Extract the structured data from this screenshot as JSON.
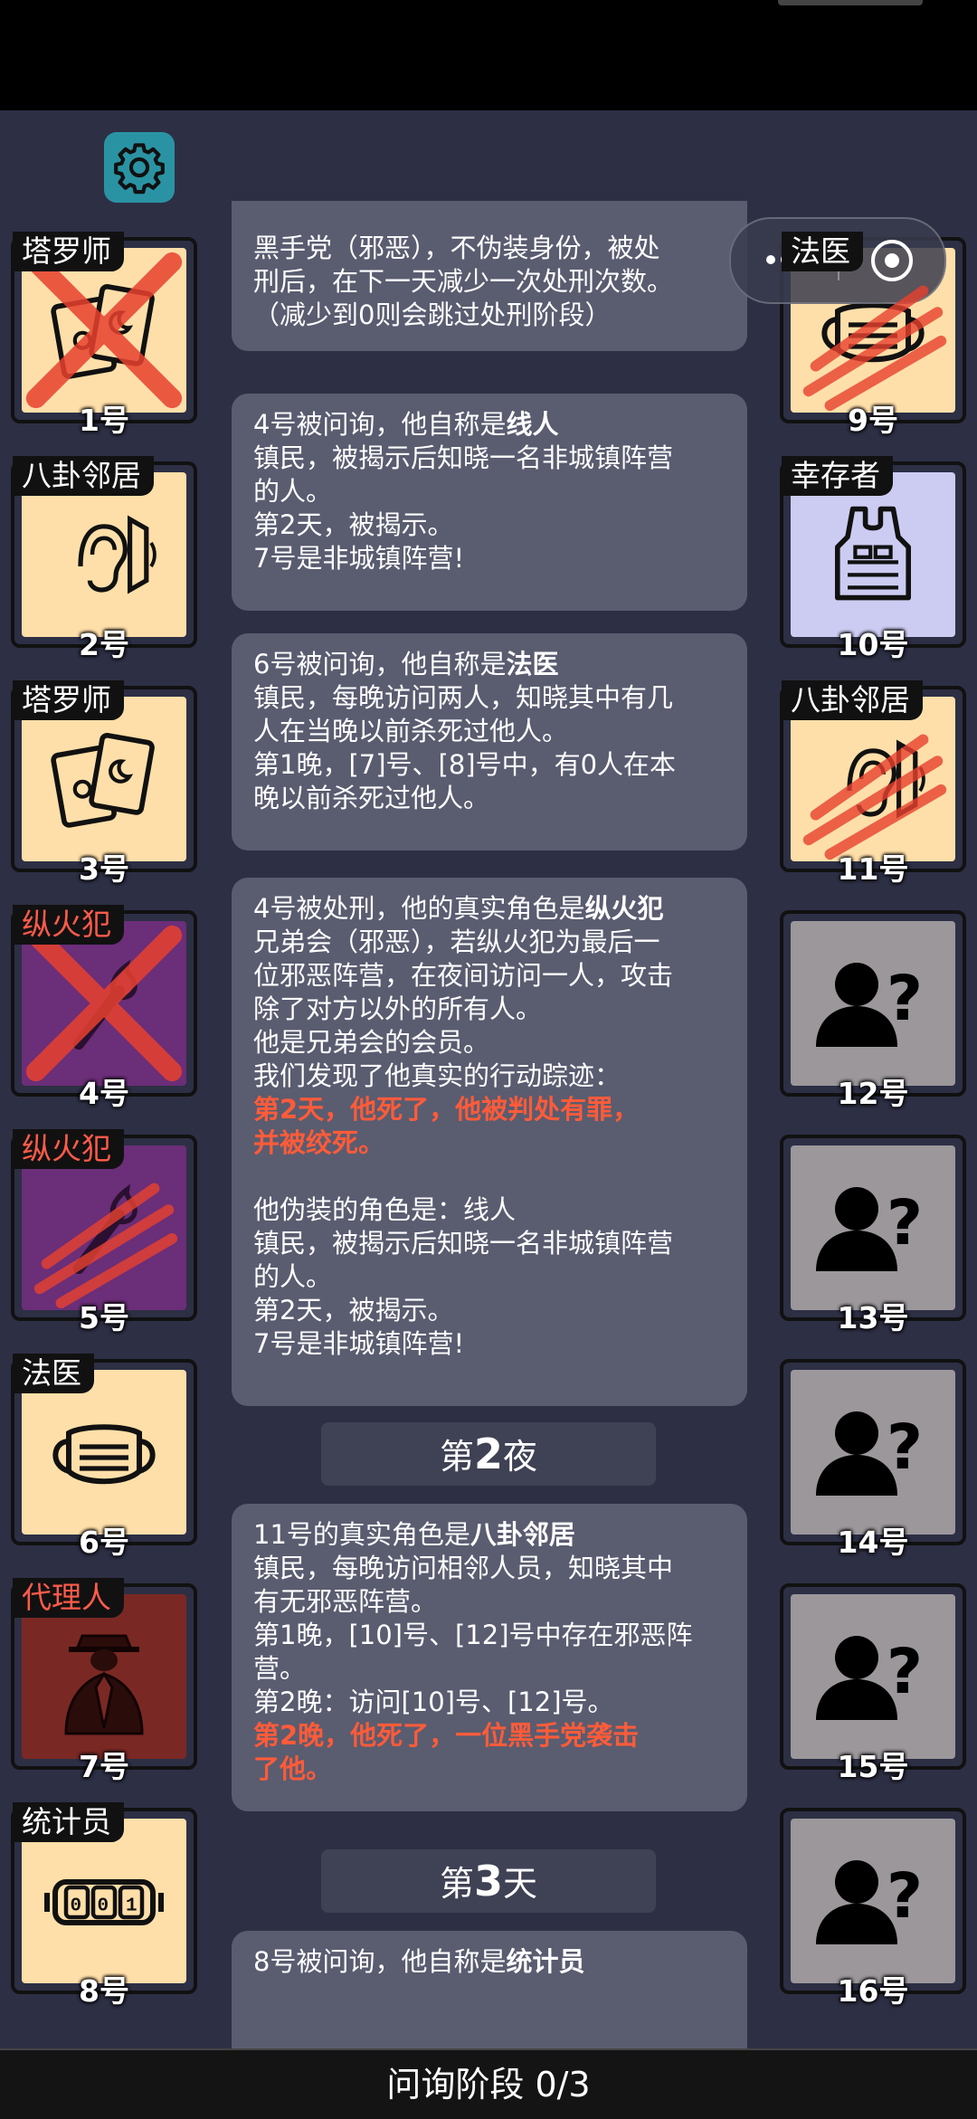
{
  "players": [
    {
      "role": "塔罗师",
      "num": "1号",
      "icon": "tarot-cards-icon",
      "bg": "#ffdfa9",
      "status": "executed",
      "role_color": "#ffffff"
    },
    {
      "role": "八卦邻居",
      "num": "2号",
      "icon": "ear-icon",
      "bg": "#ffdfa9",
      "status": "alive",
      "role_color": "#ffffff"
    },
    {
      "role": "塔罗师",
      "num": "3号",
      "icon": "tarot-cards-icon",
      "bg": "#ffdfa9",
      "status": "alive",
      "role_color": "#ffffff"
    },
    {
      "role": "纵火犯",
      "num": "4号",
      "icon": "torch-icon",
      "bg": "#6b2e78",
      "status": "executed",
      "role_color": "#ff5b4a"
    },
    {
      "role": "纵火犯",
      "num": "5号",
      "icon": "torch-icon",
      "bg": "#6b2e78",
      "status": "killed",
      "role_color": "#ff5b4a"
    },
    {
      "role": "法医",
      "num": "6号",
      "icon": "face-mask-icon",
      "bg": "#ffdfa9",
      "status": "alive",
      "role_color": "#ffffff"
    },
    {
      "role": "代理人",
      "num": "7号",
      "icon": "agent-suit-icon",
      "bg": "#7a2824",
      "status": "alive",
      "role_color": "#ff5b4a"
    },
    {
      "role": "统计员",
      "num": "8号",
      "icon": "counter-icon",
      "bg": "#ffdfa9",
      "status": "alive",
      "role_color": "#ffffff"
    },
    {
      "role": "法医",
      "num": "9号",
      "icon": "face-mask-icon",
      "bg": "#ffdfa9",
      "status": "killed",
      "role_color": "#ffffff"
    },
    {
      "role": "幸存者",
      "num": "10号",
      "icon": "vest-icon",
      "bg": "#ccccf2",
      "status": "alive",
      "role_color": "#ffffff"
    },
    {
      "role": "八卦邻居",
      "num": "11号",
      "icon": "ear-icon",
      "bg": "#ffdfa9",
      "status": "killed",
      "role_color": "#ffffff"
    },
    {
      "role": "",
      "num": "12号",
      "icon": "unknown-user-icon",
      "bg": "#9b979b",
      "status": "unknown",
      "role_color": "#ffffff"
    },
    {
      "role": "",
      "num": "13号",
      "icon": "unknown-user-icon",
      "bg": "#9b979b",
      "status": "unknown",
      "role_color": "#ffffff"
    },
    {
      "role": "",
      "num": "14号",
      "icon": "unknown-user-icon",
      "bg": "#9b979b",
      "status": "unknown",
      "role_color": "#ffffff"
    },
    {
      "role": "",
      "num": "15号",
      "icon": "unknown-user-icon",
      "bg": "#9b979b",
      "status": "unknown",
      "role_color": "#ffffff"
    },
    {
      "role": "",
      "num": "16号",
      "icon": "unknown-user-icon",
      "bg": "#9b979b",
      "status": "unknown",
      "role_color": "#ffffff"
    }
  ],
  "feed": {
    "m1": [
      "黑手党（邪恶），不伪装身份，被处",
      "刑后，在下一天减少一次处刑次数。",
      "（减少到0则会跳过处刑阶段）"
    ],
    "m2": {
      "l1a": "4号被问询，他自称是",
      "l1b": "线人",
      "l2": "镇民，被揭示后知晓一名非城镇阵营",
      "l3": "的人。",
      "l4": "第2天，被揭示。",
      "l5": "7号是非城镇阵营!"
    },
    "m3": {
      "l1a": "6号被问询，他自称是",
      "l1b": "法医",
      "l2": "镇民，每晚访问两人，知晓其中有几",
      "l3": "人在当晚以前杀死过他人。",
      "l4": "第1晚，[7]号、[8]号中，有0人在本",
      "l5": "晚以前杀死过他人。"
    },
    "m4": {
      "l1a": "4号被处刑，他的真实角色是",
      "l1b": "纵火犯",
      "l2": "兄弟会（邪恶），若纵火犯为最后一",
      "l3": "位邪恶阵营，在夜间访问一人，攻击",
      "l4": "除了对方以外的所有人。",
      "l5": "他是兄弟会的会员。",
      "l6": "我们发现了他真实的行动踪迹：",
      "l7": "第2天，他死了，他被判处有罪，",
      "l8": "并被绞死。",
      "l9": "他伪装的角色是：线人",
      "l10": "镇民，被揭示后知晓一名非城镇阵营",
      "l11": "的人。",
      "l12": "第2天，被揭示。",
      "l13": "7号是非城镇阵营!"
    },
    "night2": {
      "pre": "第",
      "n": "2",
      "post": "夜"
    },
    "m5": {
      "l1a": "11号的真实角色是",
      "l1b": "八卦邻居",
      "l2": "镇民，每晚访问相邻人员，知晓其中",
      "l3": "有无邪恶阵营。",
      "l4": "第1晚，[10]号、[12]号中存在邪恶阵",
      "l5": "营。",
      "l6": "第2晚：访问[10]号、[12]号。",
      "l7": "第2晚，他死了，一位黑手党袭击",
      "l8": "了他。"
    },
    "day3": {
      "pre": "第",
      "n": "3",
      "post": "天"
    },
    "m6": {
      "l1a": "8号被问询，他自称是",
      "l1b": "统计员"
    }
  },
  "bottom": {
    "phase": "问询阶段 0/3"
  }
}
